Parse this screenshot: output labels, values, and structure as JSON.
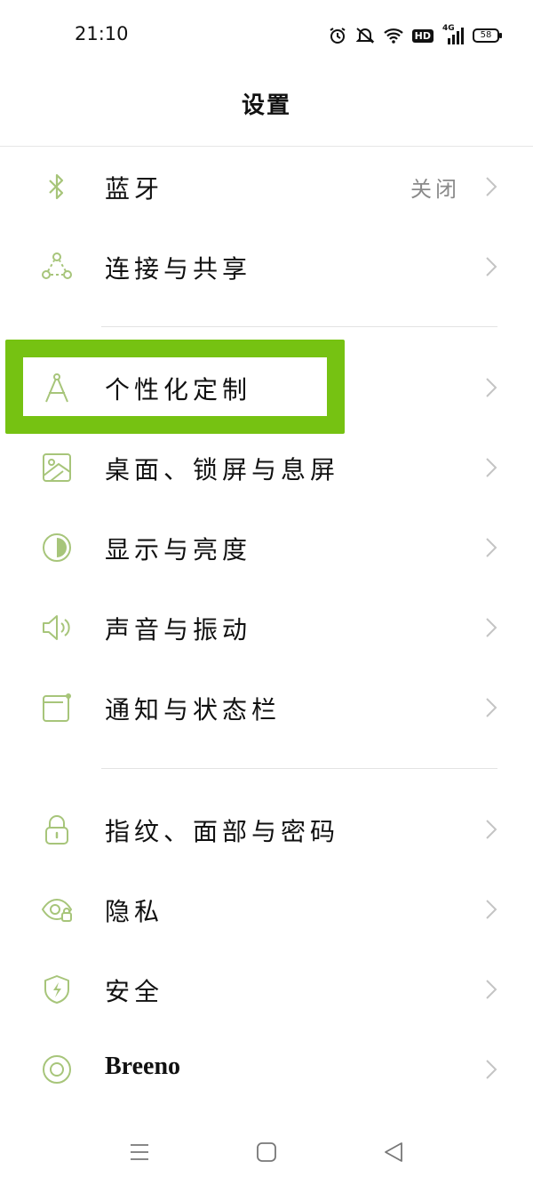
{
  "status_bar": {
    "time": "21:10",
    "network": "4G",
    "hd_badge": "HD",
    "battery": "58",
    "icons": [
      "alarm-icon",
      "mute-icon",
      "wifi-icon",
      "hd-icon",
      "signal-icon",
      "battery-icon"
    ]
  },
  "header": {
    "title": "设置"
  },
  "theme": {
    "icon_color": "#a7c57a",
    "chevron_color": "#c4c4c4",
    "highlight_color": "#76c212"
  },
  "settings": [
    {
      "label": "蓝牙",
      "value": "关闭",
      "icon": "bluetooth-icon"
    },
    {
      "label": "连接与共享",
      "icon": "connection-sharing-icon"
    },
    {
      "label": "个性化定制",
      "icon": "compass-drafting-icon"
    },
    {
      "label": "桌面、锁屏与息屏",
      "icon": "wallpaper-icon"
    },
    {
      "label": "显示与亮度",
      "icon": "brightness-icon"
    },
    {
      "label": "声音与振动",
      "icon": "speaker-icon"
    },
    {
      "label": "通知与状态栏",
      "icon": "notification-icon"
    },
    {
      "label": "指纹、面部与密码",
      "icon": "lock-icon"
    },
    {
      "label": "隐私",
      "icon": "privacy-eye-icon"
    },
    {
      "label": "安全",
      "icon": "shield-icon"
    },
    {
      "label": "Breeno",
      "icon": "breeno-icon"
    }
  ],
  "nav_bar": {
    "buttons": [
      "menu-icon",
      "home-icon",
      "back-icon"
    ]
  }
}
